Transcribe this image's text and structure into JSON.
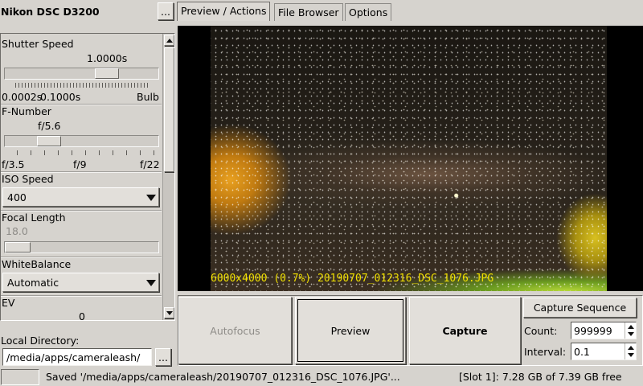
{
  "camera": {
    "title": "Nikon DSC D3200",
    "menu_button": "..."
  },
  "tabs": [
    {
      "label": "Preview / Actions",
      "active": true
    },
    {
      "label": "File Browser",
      "active": false
    },
    {
      "label": "Options",
      "active": false
    }
  ],
  "settings": {
    "shutter": {
      "label": "Shutter Speed",
      "value": "1.0000s",
      "min": "0.0002s",
      "mid": "0.1000s",
      "max": "Bulb",
      "position": 0.73
    },
    "fnumber": {
      "label": "F-Number",
      "value": "f/5.6",
      "min": "f/3.5",
      "mid": "f/9",
      "max": "f/22",
      "position": 0.22
    },
    "iso": {
      "label": "ISO Speed",
      "value": "400"
    },
    "focal": {
      "label": "Focal Length",
      "value": "18.0",
      "position": 0.0
    },
    "whitebalance": {
      "label": "WhiteBalance",
      "value": "Automatic"
    },
    "ev": {
      "label": "EV",
      "value": "0"
    }
  },
  "local_directory": {
    "label": "Local Directory:",
    "value": "/media/apps/cameraleash/",
    "browse": "..."
  },
  "preview": {
    "overlay": "6000x4000 (0.7%) 20190707_012316_DSC_1076.JPG"
  },
  "actions": {
    "autofocus": "Autofocus",
    "preview": "Preview",
    "capture": "Capture",
    "capture_sequence": "Capture Sequence"
  },
  "sequence": {
    "count_label": "Count:",
    "count_value": "999999",
    "interval_label": "Interval:",
    "interval_value": "0.1"
  },
  "status": {
    "message": "Saved '/media/apps/cameraleash/20190707_012316_DSC_1076.JPG'...",
    "storage": "[Slot 1]: 7.28 GB of 7.39 GB free"
  },
  "colors": {
    "overlay_text": "#f0e000",
    "background": "#d6d3ce"
  }
}
